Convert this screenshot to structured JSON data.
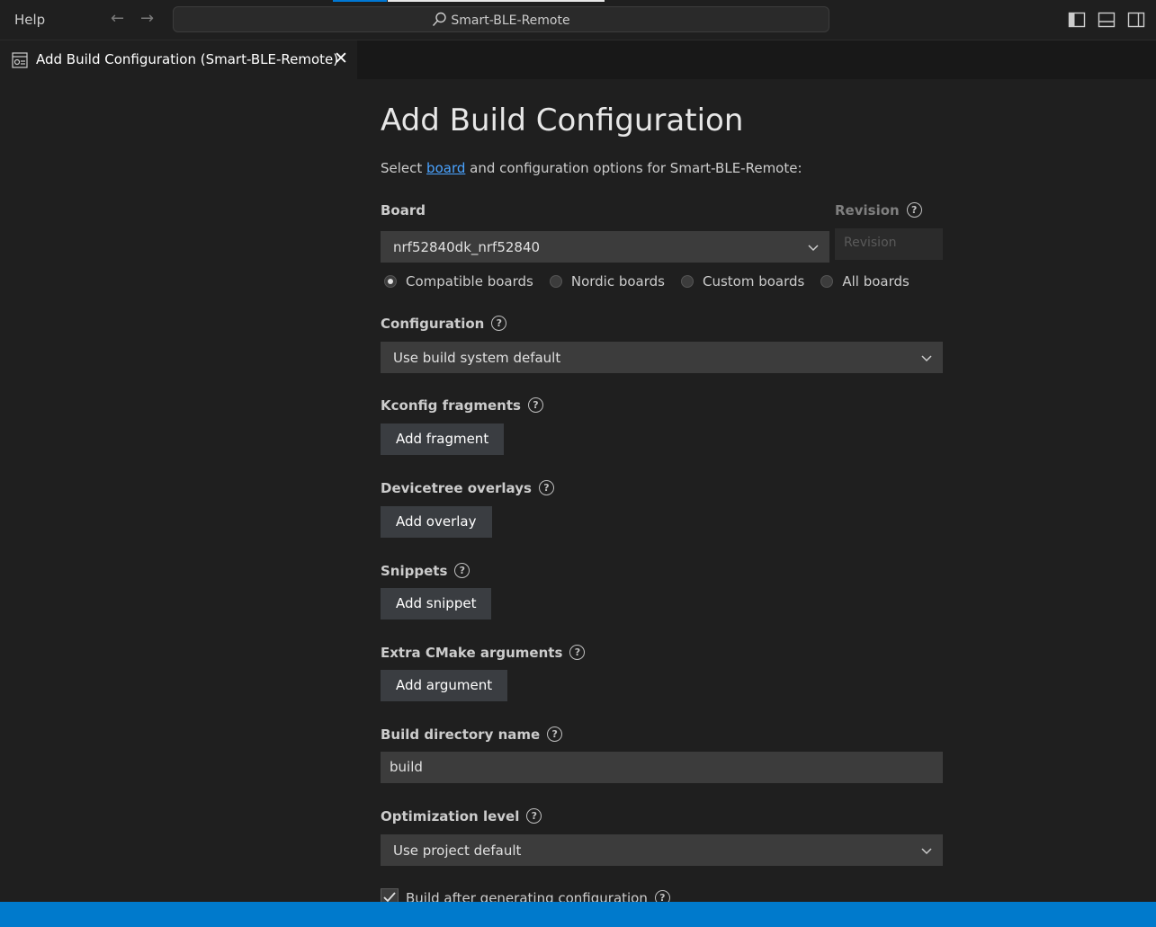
{
  "titlebar": {
    "menu_help": "Help",
    "search_text": "Smart-BLE-Remote"
  },
  "tab": {
    "label": "Add Build Configuration (Smart-BLE-Remote)",
    "close": "✕"
  },
  "page": {
    "title": "Add Build Configuration",
    "intro_prefix": "Select ",
    "intro_link": "board",
    "intro_suffix": " and configuration options for Smart-BLE-Remote:"
  },
  "board": {
    "label": "Board",
    "selected": "nrf52840dk_nrf52840",
    "revision_label": "Revision",
    "revision_placeholder": "Revision",
    "filters": [
      {
        "label": "Compatible boards",
        "checked": true
      },
      {
        "label": "Nordic boards",
        "checked": false
      },
      {
        "label": "Custom boards",
        "checked": false
      },
      {
        "label": "All boards",
        "checked": false
      }
    ]
  },
  "configuration": {
    "label": "Configuration",
    "selected": "Use build system default"
  },
  "kconfig": {
    "label": "Kconfig fragments",
    "button": "Add fragment"
  },
  "devicetree": {
    "label": "Devicetree overlays",
    "button": "Add overlay"
  },
  "snippets": {
    "label": "Snippets",
    "button": "Add snippet"
  },
  "cmake": {
    "label": "Extra CMake arguments",
    "button": "Add argument"
  },
  "build_dir": {
    "label": "Build directory name",
    "value": "build"
  },
  "optimization": {
    "label": "Optimization level",
    "selected": "Use project default"
  },
  "build_after": {
    "label": "Build after generating configuration",
    "checked": true
  },
  "colors": {
    "accent": "#007acc",
    "link": "#4aa3ff",
    "background": "#1f1f1f"
  },
  "help_glyph": "?"
}
